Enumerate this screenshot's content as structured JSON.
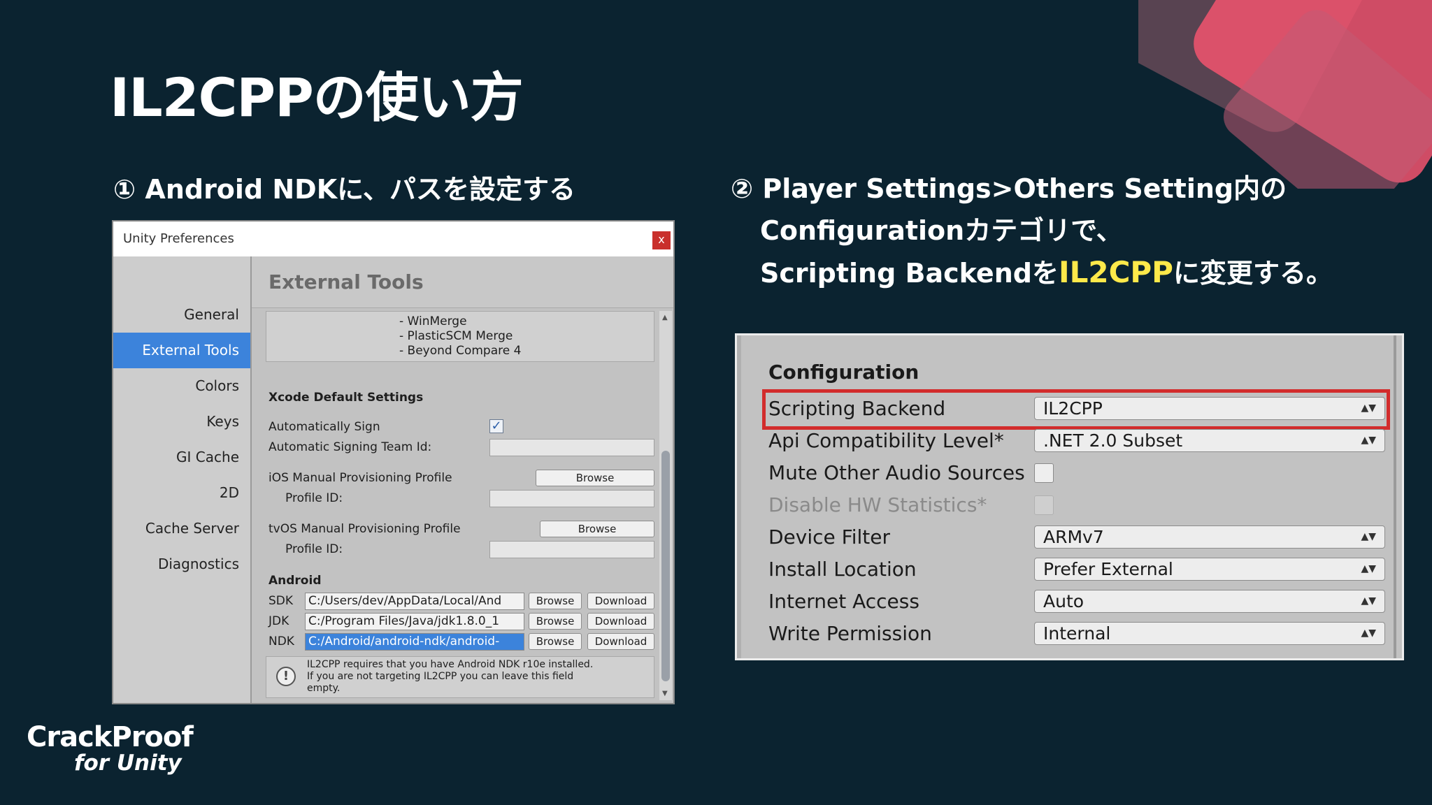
{
  "slide": {
    "title": "IL2CPPの使い方",
    "step1": "① Android NDKに、パスを設定する",
    "step2_line1": "② Player Settings>Others Setting内の",
    "step2_line2": "Configurationカテゴリで、",
    "step2_line3_a": "Scripting Backendを",
    "step2_line3_hl": "IL2CPP",
    "step2_line3_b": "に変更する。",
    "accent_color": "#ffe94a",
    "logo_line1": "CrackProof",
    "logo_line2": "for Unity"
  },
  "prefs": {
    "window_title": "Unity Preferences",
    "close_label": "x",
    "sidebar": [
      "General",
      "External Tools",
      "Colors",
      "Keys",
      "GI Cache",
      "2D",
      "Cache Server",
      "Diagnostics"
    ],
    "active_item": "External Tools",
    "header": "External Tools",
    "merge_tools": [
      "- WinMerge",
      "- PlasticSCM Merge",
      "- Beyond Compare 4"
    ],
    "xcode_heading": "Xcode Default Settings",
    "auto_sign_label": "Automatically Sign",
    "auto_sign_checked": "✓",
    "team_id_label": "Automatic Signing Team Id:",
    "ios_profile_label": "iOS Manual Provisioning Profile",
    "tvos_profile_label": "tvOS Manual Provisioning Profile",
    "profile_id_label": "Profile ID:",
    "browse_label": "Browse",
    "download_label": "Download",
    "android_heading": "Android",
    "sdk_label": "SDK",
    "sdk_path": "C:/Users/dev/AppData/Local/And",
    "jdk_label": "JDK",
    "jdk_path": "C:/Program Files/Java/jdk1.8.0_1",
    "ndk_label": "NDK",
    "ndk_path": "C:/Android/android-ndk/android-",
    "note_line1": "IL2CPP requires that you have Android NDK r10e installed.",
    "note_line2": "If you are not targeting IL2CPP you can leave this field",
    "note_line3": "empty.",
    "note_icon": "!"
  },
  "config": {
    "heading": "Configuration",
    "rows": [
      {
        "label": "Scripting Backend",
        "value": "IL2CPP"
      },
      {
        "label": "Api Compatibility Level*",
        "value": ".NET 2.0 Subset"
      },
      {
        "label": "Mute Other Audio Sources",
        "value": ""
      },
      {
        "label": "Disable HW Statistics*",
        "value": ""
      },
      {
        "label": "Device Filter",
        "value": "ARMv7"
      },
      {
        "label": "Install Location",
        "value": "Prefer External"
      },
      {
        "label": "Internet Access",
        "value": "Auto"
      },
      {
        "label": "Write Permission",
        "value": "Internal"
      }
    ],
    "dropdown_arrow": "▲▼",
    "highlight_color": "#d22c2c"
  }
}
